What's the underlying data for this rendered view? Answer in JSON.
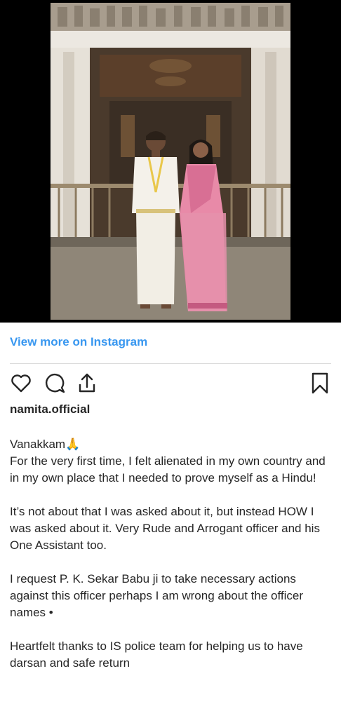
{
  "post": {
    "image_alt": "Couple standing in front of temple gopuram entrance",
    "view_more_label": "View more on Instagram",
    "username": "namita.official"
  },
  "icons": {
    "like": "heart-icon",
    "comment": "comment-icon",
    "share": "share-icon",
    "save": "bookmark-icon"
  },
  "caption": {
    "p1": "Vanakkam🙏\nFor the very first time, I felt alienated in my own country and in my own place that I needed to prove myself as a Hindu!",
    "p2": "It’s not about that I was asked about it, but instead HOW I was asked about it. Very Rude and Arrogant officer and his One Assistant too.",
    "p3": "I request P. K. Sekar Babu ji to take necessary actions against this officer perhaps I am wrong about the officer\nnames •",
    "p4": "Heartfelt thanks to IS police team for helping us to have darsan and safe return"
  },
  "colors": {
    "link": "#3897f0",
    "text": "#262626",
    "divider": "#dbdbdb"
  }
}
